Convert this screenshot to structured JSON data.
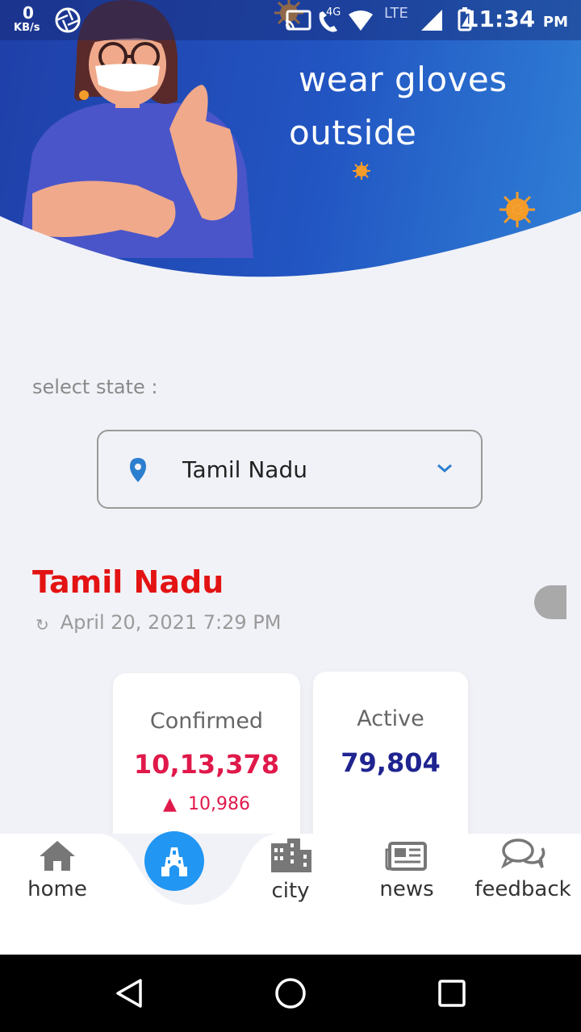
{
  "status_bar": {
    "data_speed": "0",
    "data_unit": "KB/s",
    "network_4g": "4G",
    "network_lte": "LTE",
    "time": "11:34",
    "ampm": "PM"
  },
  "banner": {
    "line1": "wear gloves",
    "line2": "outside"
  },
  "selector": {
    "label": "select state :",
    "selected": "Tamil Nadu"
  },
  "summary": {
    "state_name": "Tamil Nadu",
    "updated": "April 20, 2021 7:29 PM",
    "cards": {
      "confirmed": {
        "label": "Confirmed",
        "value": "10,13,378",
        "delta": "10,986",
        "color": "#e0194a"
      },
      "active": {
        "label": "Active",
        "value": "79,804",
        "color": "#1f2490"
      }
    }
  },
  "bottom_nav": {
    "home": "home",
    "city": "city",
    "news": "news",
    "feedback": "feedback"
  },
  "colors": {
    "accent": "#2196f3",
    "state_title": "#e31313",
    "banner_dark": "#1f3fa8",
    "banner_light": "#2f7fd6"
  }
}
